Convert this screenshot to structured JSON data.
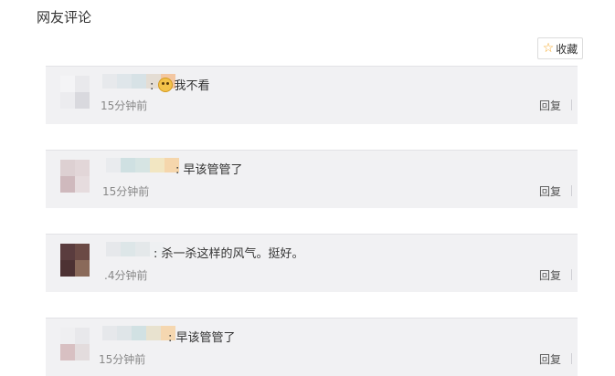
{
  "page": {
    "title": "网友评论"
  },
  "favorite": {
    "label": "收藏",
    "icon": "star-icon"
  },
  "comments": [
    {
      "text": "我不看",
      "time": "15分钟前",
      "reply": "回复",
      "has_emoji": true
    },
    {
      "text": "早该管管了",
      "time": "15分钟前",
      "reply": "回复"
    },
    {
      "text": "杀一杀这样的风气。挺好。",
      "time": ".4分钟前",
      "reply": "回复"
    },
    {
      "text": "早该管管了",
      "time": "15分钟前",
      "reply": "回复"
    }
  ],
  "colors": {
    "card_bg": "#f1f1f3",
    "star": "#f5a623",
    "time": "#888888"
  }
}
